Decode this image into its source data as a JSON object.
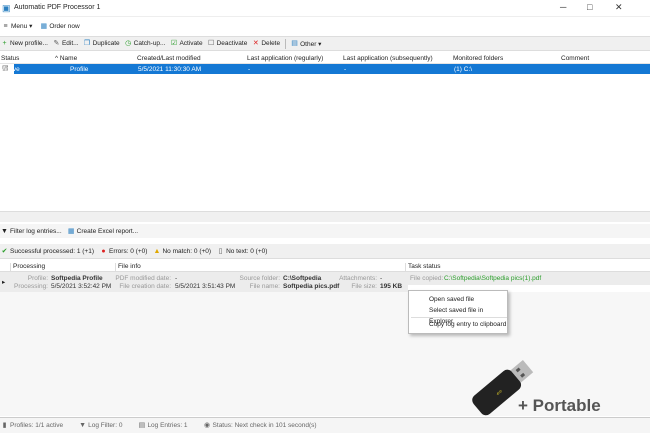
{
  "window": {
    "title": "Automatic PDF Processor 1",
    "controls": [
      "─",
      "□",
      "✕"
    ]
  },
  "menu": {
    "items": [
      "Menu ▾",
      "Order now"
    ]
  },
  "toolbar": {
    "items": [
      {
        "icon": "plus-icon",
        "glyph": "+",
        "label": "New profile...",
        "color": "#2a9d2a"
      },
      {
        "icon": "wrench-icon",
        "glyph": "✎",
        "label": "Edit...",
        "color": "#555"
      },
      {
        "icon": "duplicate-icon",
        "glyph": "❐",
        "label": "Duplicate",
        "color": "#2a7fc0"
      },
      {
        "icon": "clock-icon",
        "glyph": "◷",
        "label": "Catch-up...",
        "color": "#2a9d2a"
      },
      {
        "icon": "checkbox-checked-icon",
        "glyph": "☑",
        "label": "Activate",
        "color": "#2a9d2a"
      },
      {
        "icon": "checkbox-empty-icon",
        "glyph": "☐",
        "label": "Deactivate",
        "color": "#555"
      },
      {
        "icon": "delete-icon",
        "glyph": "✕",
        "label": "Delete",
        "color": "#d22"
      },
      {
        "icon": "calendar-icon",
        "glyph": "▤",
        "label": "Other ▾",
        "color": "#2a7fc0"
      }
    ]
  },
  "profiles": {
    "columns": [
      "Status",
      "^  Name",
      "Created/Last modified",
      "Last application (regularly)",
      "Last application (subsequently)",
      "Monitored folders",
      "Comment"
    ],
    "rows": [
      [
        "Active",
        "Profile",
        "5/5/2021 11:30:30 AM",
        "-",
        "-",
        "(1) C:\\",
        ""
      ]
    ]
  },
  "log_toolbar": {
    "items": [
      "Filter log entries...",
      "Create Excel report..."
    ]
  },
  "filters": [
    {
      "icon": "check-icon",
      "glyph": "✔",
      "color": "#2a9d2a",
      "label": "Successful processed: 1  (+1)"
    },
    {
      "icon": "error-icon",
      "glyph": "●",
      "color": "#d22",
      "label": "Errors: 0  (+0)"
    },
    {
      "icon": "warning-icon",
      "glyph": "▲",
      "color": "#e0a800",
      "label": "No match: 0  (+0)"
    },
    {
      "icon": "document-icon",
      "glyph": "▯",
      "color": "#555",
      "label": "No text: 0  (+0)"
    }
  ],
  "log": {
    "columns": [
      "Processing",
      "File info",
      "Task status"
    ],
    "entry": {
      "profile_label": "Profile:",
      "profile": "Softpedia Profile",
      "processing_label": "Processing:",
      "processing": "5/5/2021 3:52:42 PM",
      "pdf_mod_label": "PDF modified date:",
      "pdf_mod": "-",
      "creation_label": "File creation date:",
      "creation": "5/5/2021 3:51:43 PM",
      "source_label": "Source folder:",
      "source": "C:\\Softpedia",
      "filename_label": "File name:",
      "filename": "Softpedia pics.pdf",
      "attach_label": "Attachments:",
      "attach": "-",
      "size_label": "File size:",
      "size": "195 KB",
      "copied_label": "File copied:",
      "copied": "C:\\Softpedia\\Softpedia pics(1).pdf"
    }
  },
  "context_menu": {
    "items": [
      "Open saved file",
      "Select saved file in Explorer",
      "Copy log entry to clipboard"
    ]
  },
  "watermark": {
    "text": "+ Portable"
  },
  "statusbar": {
    "items": [
      "Profiles: 1/1 active",
      "Log Filter: 0",
      "Log Entries: 1",
      "Status: Next check in 101 second(s)"
    ]
  }
}
